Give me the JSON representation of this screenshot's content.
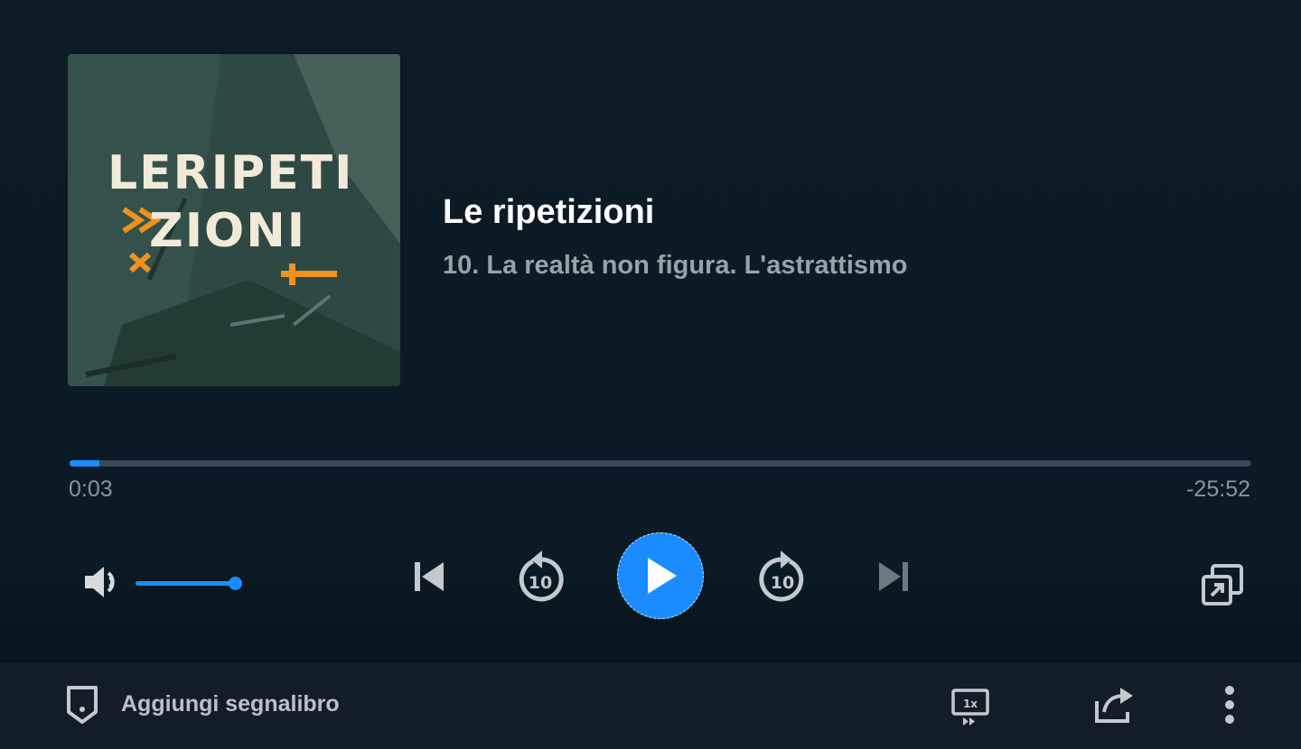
{
  "player": {
    "cover": {
      "line1": "LERIPETI",
      "line2": "ZIONI"
    },
    "title": "Le ripetizioni",
    "episode": "10. La realtà non figura. L'astrattismo",
    "progress": {
      "elapsed": "0:03",
      "remaining": "-25:52",
      "fraction": 0.025
    },
    "volume": {
      "fraction": 1.0
    },
    "controls": {
      "rewind_seconds": "10",
      "forward_seconds": "10"
    }
  },
  "bottom_bar": {
    "bookmark_label": "Aggiungi segnalibro",
    "speed_label": "1x"
  },
  "colors": {
    "accent": "#1a8cff",
    "background": "#0c1a24",
    "bottom_bar": "#121d27",
    "cover_accent": "#f0921e"
  },
  "icons": [
    "volume-icon",
    "skip-previous-icon",
    "rewind-10-icon",
    "play-icon",
    "forward-10-icon",
    "skip-next-icon",
    "picture-in-picture-icon",
    "bookmark-icon",
    "playback-speed-icon",
    "share-icon",
    "more-vertical-icon"
  ]
}
